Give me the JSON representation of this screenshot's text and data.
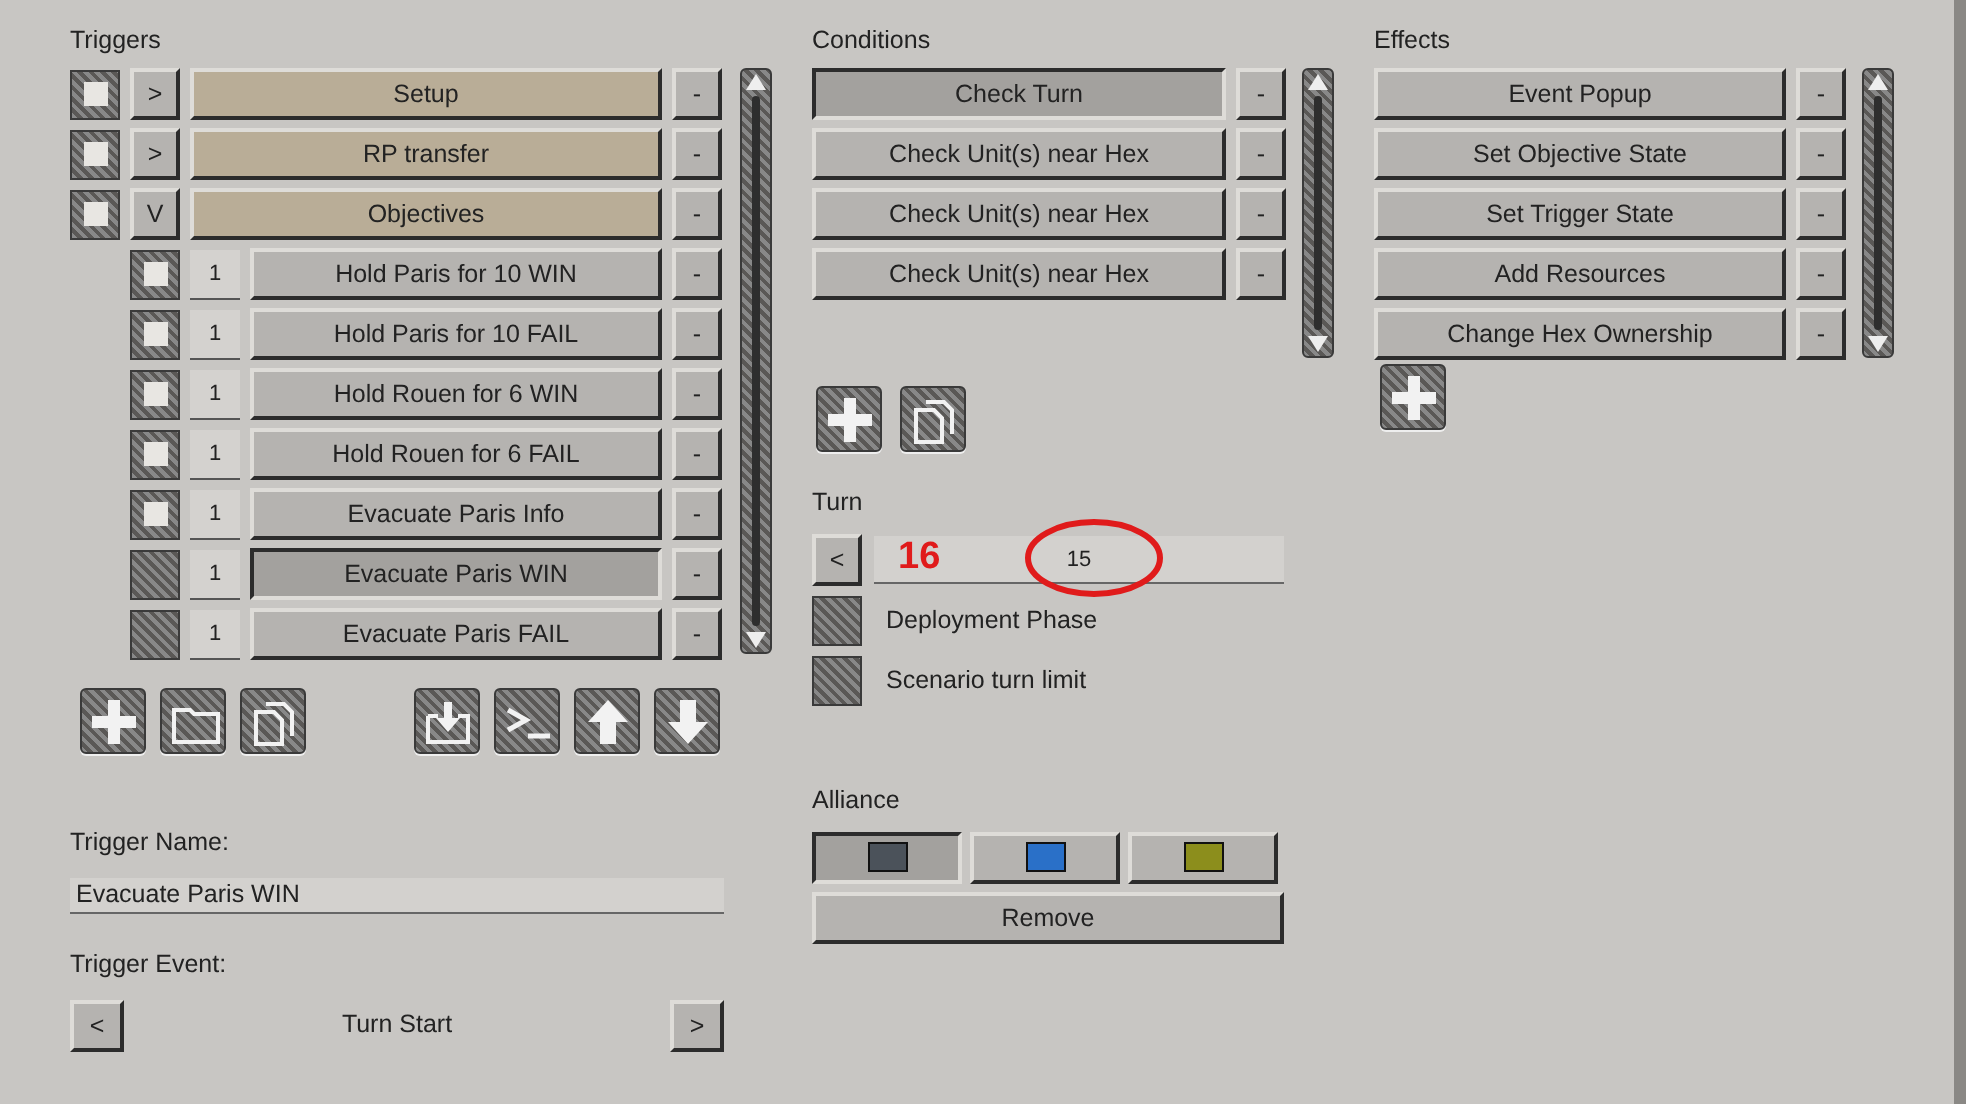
{
  "triggers": {
    "title": "Triggers",
    "items": [
      {
        "kind": "folder",
        "toggle": ">",
        "label": "Setup",
        "remove": "-",
        "checked": true,
        "selected": false
      },
      {
        "kind": "folder",
        "toggle": ">",
        "label": "RP transfer",
        "remove": "-",
        "checked": true,
        "selected": false
      },
      {
        "kind": "folder",
        "toggle": "V",
        "label": "Objectives",
        "remove": "-",
        "checked": true,
        "selected": false,
        "children": [
          {
            "kind": "trigger",
            "order": "1",
            "label": "Hold Paris for 10 WIN",
            "remove": "-",
            "checked": true,
            "selected": false
          },
          {
            "kind": "trigger",
            "order": "1",
            "label": "Hold Paris for 10 FAIL",
            "remove": "-",
            "checked": true,
            "selected": false
          },
          {
            "kind": "trigger",
            "order": "1",
            "label": "Hold Rouen for 6 WIN",
            "remove": "-",
            "checked": true,
            "selected": false
          },
          {
            "kind": "trigger",
            "order": "1",
            "label": "Hold Rouen for 6 FAIL",
            "remove": "-",
            "checked": true,
            "selected": false
          },
          {
            "kind": "trigger",
            "order": "1",
            "label": "Evacuate Paris Info",
            "remove": "-",
            "checked": true,
            "selected": false
          },
          {
            "kind": "trigger",
            "order": "1",
            "label": "Evacuate Paris WIN",
            "remove": "-",
            "checked": false,
            "selected": true
          },
          {
            "kind": "trigger",
            "order": "1",
            "label": "Evacuate Paris FAIL",
            "remove": "-",
            "checked": false,
            "selected": false
          }
        ]
      }
    ]
  },
  "trigger_name": {
    "label": "Trigger Name:",
    "value": "Evacuate Paris WIN"
  },
  "trigger_event": {
    "label": "Trigger Event:",
    "prev": "<",
    "value": "Turn Start",
    "next": ">"
  },
  "conditions": {
    "title": "Conditions",
    "items": [
      {
        "label": "Check Turn",
        "remove": "-",
        "selected": true
      },
      {
        "label": "Check Unit(s) near Hex",
        "remove": "-",
        "selected": false
      },
      {
        "label": "Check Unit(s) near Hex",
        "remove": "-",
        "selected": false
      },
      {
        "label": "Check Unit(s) near Hex",
        "remove": "-",
        "selected": false
      }
    ]
  },
  "turn": {
    "label": "Turn",
    "prev": "<",
    "value": "15",
    "options": [
      {
        "label": "Deployment Phase",
        "checked": false
      },
      {
        "label": "Scenario turn limit",
        "checked": false
      }
    ]
  },
  "annotation": {
    "text": "16"
  },
  "alliance": {
    "label": "Alliance",
    "options": [
      {
        "color": "#4b525a",
        "selected": true
      },
      {
        "color": "#2a70c8",
        "selected": false
      },
      {
        "color": "#8c8e1c",
        "selected": false
      }
    ],
    "remove": "Remove"
  },
  "effects": {
    "title": "Effects",
    "items": [
      {
        "label": "Event Popup",
        "remove": "-",
        "selected": false
      },
      {
        "label": "Set Objective State",
        "remove": "-",
        "selected": false
      },
      {
        "label": "Set Trigger State",
        "remove": "-",
        "selected": false
      },
      {
        "label": "Add Resources",
        "remove": "-",
        "selected": false
      },
      {
        "label": "Change Hex Ownership",
        "remove": "-",
        "selected": false
      }
    ]
  }
}
